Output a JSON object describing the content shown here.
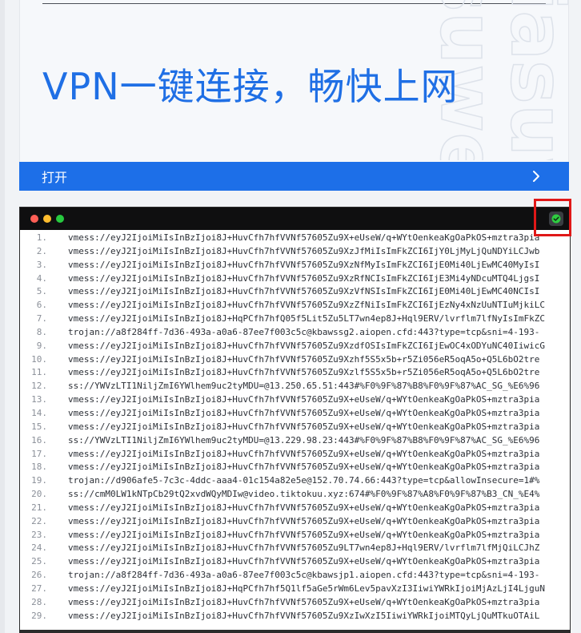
{
  "hero": {
    "title": "VPN一键连接，畅快上网",
    "watermark_1": "suwe",
    "watermark_2": "jiasuw"
  },
  "open_button": {
    "label": "打开"
  },
  "colors": {
    "accent": "#1d6fe8",
    "hero_text": "#1f6fe5",
    "terminal_bar": "#0f0f10",
    "highlight": "#e01818"
  },
  "terminal": {
    "icons": {
      "close": "red-dot",
      "minimize": "yellow-dot",
      "maximize": "green-dot",
      "copy": "check-circle-icon"
    },
    "lines": [
      {
        "n": "1.",
        "t": "vmess://eyJ2IjoiMiIsInBzIjoi8J+HuvCfh7hfVVNf57605Zu9X+eUseW/q+WYtOenkeaKgOaPkOS+mztra3pia"
      },
      {
        "n": "2.",
        "t": "vmess://eyJ2IjoiMiIsInBzIjoi8J+HuvCfh7hfVVNf57605Zu9XzJfMiIsImFkZCI6IjY0LjMyLjQuNDYiLCJwb"
      },
      {
        "n": "3.",
        "t": "vmess://eyJ2IjoiMiIsInBzIjoi8J+HuvCfh7hfVVNf57605Zu9XzNfMyIsImFkZCI6IjE0Mi40LjEwMC40MyIsI"
      },
      {
        "n": "4.",
        "t": "vmess://eyJ2IjoiMiIsInBzIjoi8J+HuvCfh7hfVVNf57605Zu9XzRfNCIsImFkZCI6IjE3Mi4yNDcuMTQ4LjgsI"
      },
      {
        "n": "5.",
        "t": "vmess://eyJ2IjoiMiIsInBzIjoi8J+HuvCfh7hfVVNf57605Zu9XzVfNSIsImFkZCI6IjE0Mi40LjEwMC40NCIsI"
      },
      {
        "n": "6.",
        "t": "vmess://eyJ2IjoiMiIsInBzIjoi8J+HuvCfh7hfVVNf57605Zu9XzZfNiIsImFkZCI6IjEzNy4xNzUuNTIuMjkiLC"
      },
      {
        "n": "7.",
        "t": "vmess://eyJ2IjoiMiIsInBzIjoi8J+HqPCfh7hfQ05f5Lit5Zu5LT7wn4ep8J+Hql9ERV/lvrflm7lfNyIsImFkZC"
      },
      {
        "n": "8.",
        "t": "trojan://a8f284ff-7d36-493a-a0a6-87ee7f003c5c@kbawssg2.aiopen.cfd:443?type=tcp&sni=4-193-"
      },
      {
        "n": "9.",
        "t": "vmess://eyJ2IjoiMiIsInBzIjoi8J+HuvCfh7hfVVNf57605Zu9XzdfOSIsImFkZCI6IjEwOC4xODYuNC40IiwicG"
      },
      {
        "n": "10.",
        "t": "vmess://eyJ2IjoiMiIsInBzIjoi8J+HuvCfh7hfVVNf57605Zu9Xzhf5S5x5b+r5Zi056eR5oqA5o+Q5L6bO2tre"
      },
      {
        "n": "11.",
        "t": "vmess://eyJ2IjoiMiIsInBzIjoi8J+HuvCfh7hfVVNf57605Zu9Xzlf5S5x5b+r5Zi056eR5oqA5o+Q5L6bO2tre"
      },
      {
        "n": "12.",
        "t": "ss://YWVzLTI1NiljZmI6YWlhem9uc2tyMDU=@13.250.65.51:443#%F0%9F%87%B8%F0%9F%87%AC_SG_%E6%96"
      },
      {
        "n": "13.",
        "t": "vmess://eyJ2IjoiMiIsInBzIjoi8J+HuvCfh7hfVVNf57605Zu9X+eUseW/q+WYtOenkeaKgOaPkOS+mztra3pia"
      },
      {
        "n": "14.",
        "t": "vmess://eyJ2IjoiMiIsInBzIjoi8J+HuvCfh7hfVVNf57605Zu9X+eUseW/q+WYtOenkeaKgOaPkOS+mztra3pia"
      },
      {
        "n": "15.",
        "t": "vmess://eyJ2IjoiMiIsInBzIjoi8J+HuvCfh7hfVVNf57605Zu9X+eUseW/q+WYtOenkeaKgOaPkOS+mztra3pia"
      },
      {
        "n": "16.",
        "t": "ss://YWVzLTI1NiljZmI6YWlhem9uc2tyMDU=@13.229.98.23:443#%F0%9F%87%B8%F0%9F%87%AC_SG_%E6%96"
      },
      {
        "n": "17.",
        "t": "vmess://eyJ2IjoiMiIsInBzIjoi8J+HuvCfh7hfVVNf57605Zu9X+eUseW/q+WYtOenkeaKgOaPkOS+mztra3pia"
      },
      {
        "n": "18.",
        "t": "vmess://eyJ2IjoiMiIsInBzIjoi8J+HuvCfh7hfVVNf57605Zu9X+eUseW/q+WYtOenkeaKgOaPkOS+mztra3pia"
      },
      {
        "n": "19.",
        "t": "trojan://d906afe5-7c3c-4ddc-aaa4-01c154a82e5e@152.70.74.66:443?type=tcp&allowInsecure=1#%"
      },
      {
        "n": "20.",
        "t": "ss://cmM0LW1kNTpCb29tQ2xvdWQyMDIw@video.tiktokuu.xyz:674#%F0%9F%87%A8%F0%9F%87%B3_CN_%E4%"
      },
      {
        "n": "21.",
        "t": "vmess://eyJ2IjoiMiIsInBzIjoi8J+HuvCfh7hfVVNf57605Zu9X+eUseW/q+WYtOenkeaKgOaPkOS+mztra3pia"
      },
      {
        "n": "22.",
        "t": "vmess://eyJ2IjoiMiIsInBzIjoi8J+HuvCfh7hfVVNf57605Zu9X+eUseW/q+WYtOenkeaKgOaPkOS+mztra3pia"
      },
      {
        "n": "23.",
        "t": "vmess://eyJ2IjoiMiIsInBzIjoi8J+HuvCfh7hfVVNf57605Zu9X+eUseW/q+WYtOenkeaKgOaPkOS+mztra3pia"
      },
      {
        "n": "24.",
        "t": "vmess://eyJ2IjoiMiIsInBzIjoi8J+HuvCfh7hfVVNf57605Zu9LT7wn4ep8J+Hql9ERV/lvrflm7lfMjQiLCJhZ"
      },
      {
        "n": "25.",
        "t": "vmess://eyJ2IjoiMiIsInBzIjoi8J+HuvCfh7hfVVNf57605Zu9X+eUseW/q+WYtOenkeaKgOaPkOS+mztra3pia"
      },
      {
        "n": "26.",
        "t": "trojan://a8f284ff-7d36-493a-a0a6-87ee7f003c5c@kbawsjp1.aiopen.cfd:443?type=tcp&sni=4-193-"
      },
      {
        "n": "27.",
        "t": "vmess://eyJ2IjoiMiIsInBzIjoi8J+HqPCfh7hf5Q1lf5aGe5rWm6Lev5pavXzI3IiwiYWRkIjoiMjAzLjI4LjguN"
      },
      {
        "n": "28.",
        "t": "vmess://eyJ2IjoiMiIsInBzIjoi8J+HuvCfh7hfVVNf57605Zu9X+eUseW/q+WYtOenkeaKgOaPkOS+mztra3pia"
      },
      {
        "n": "29.",
        "t": "vmess://eyJ2IjoiMiIsInBzIjoi8J+HuvCfh7hfVVNf57605Zu9XzIwXzI5IiwiYWRkIjoiMTQyLjQuMTkuOTAiL"
      }
    ]
  }
}
